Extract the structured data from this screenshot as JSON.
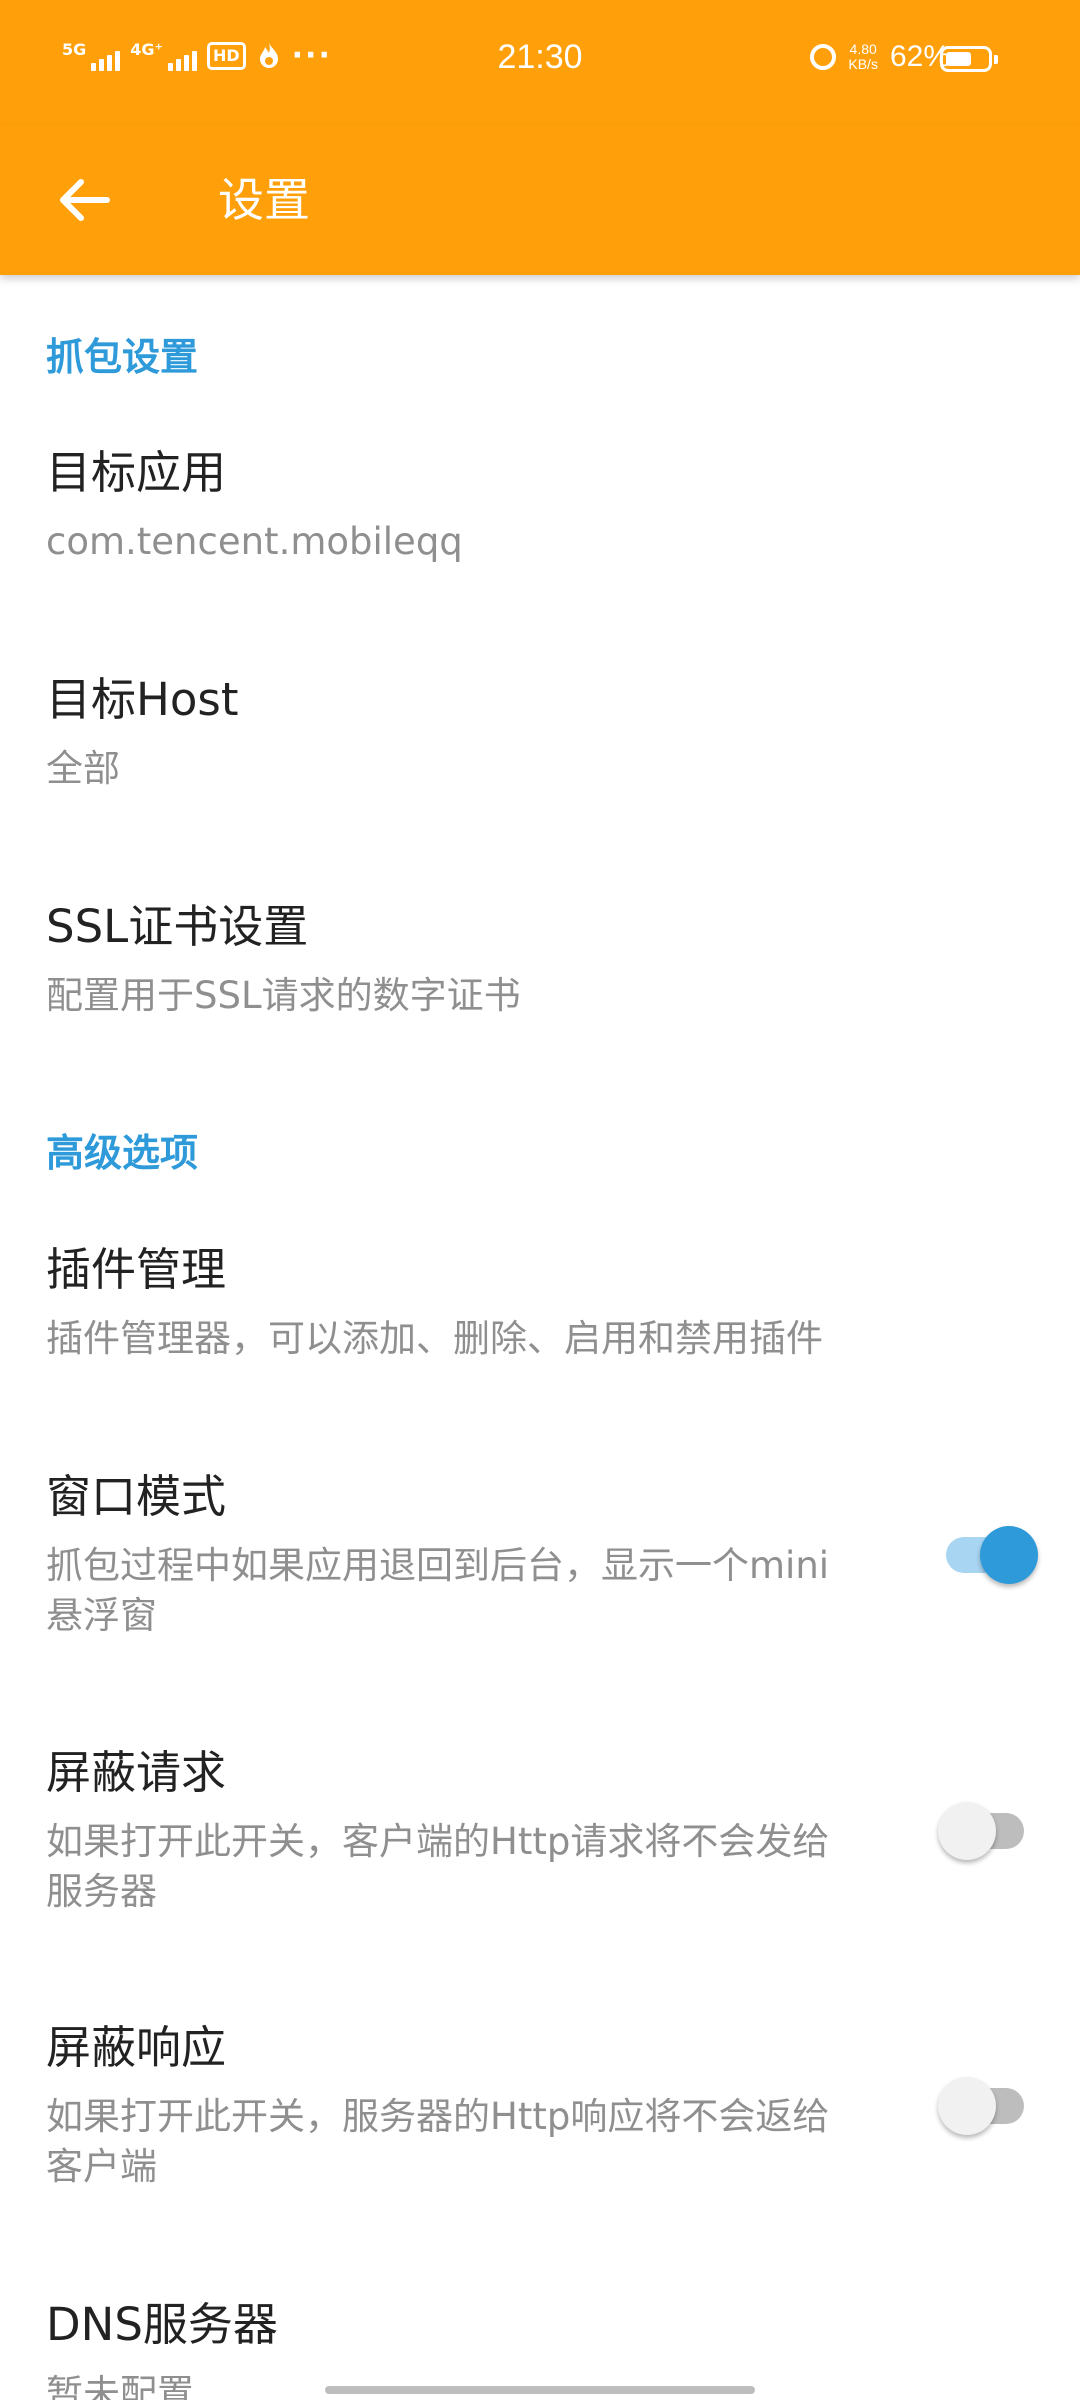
{
  "status_bar": {
    "signal1": "5G",
    "signal2": "4G⁺",
    "hd": "HD",
    "more": "···",
    "time": "21:30",
    "net_speed_value": "4.80",
    "net_speed_unit": "KB/s",
    "battery": "62%",
    "battery_level": 0.62
  },
  "toolbar": {
    "title": "设置"
  },
  "sections": {
    "capture": {
      "title": "抓包设置",
      "target_app": {
        "title": "目标应用",
        "summary": "com.tencent.mobileqq"
      },
      "target_host": {
        "title": "目标Host",
        "summary": "全部"
      },
      "ssl": {
        "title": "SSL证书设置",
        "summary": "配置用于SSL请求的数字证书"
      }
    },
    "advanced": {
      "title": "高级选项",
      "plugins": {
        "title": "插件管理",
        "summary": "插件管理器，可以添加、删除、启用和禁用插件"
      },
      "window_mode": {
        "title": "窗口模式",
        "summary": "抓包过程中如果应用退回到后台，显示一个mini悬浮窗",
        "enabled": true
      },
      "block_request": {
        "title": "屏蔽请求",
        "summary": "如果打开此开关，客户端的Http请求将不会发给服务器",
        "enabled": false
      },
      "block_response": {
        "title": "屏蔽响应",
        "summary": "如果打开此开关，服务器的Http响应将不会返给客户端",
        "enabled": false
      },
      "dns": {
        "title": "DNS服务器",
        "summary": "暂未配置"
      }
    }
  },
  "colors": {
    "app_bar": "#FFA00A",
    "accent": "#2E9AD9",
    "switch_on_track": "#A8D5F2",
    "switch_off_track": "#BDBDBD"
  }
}
